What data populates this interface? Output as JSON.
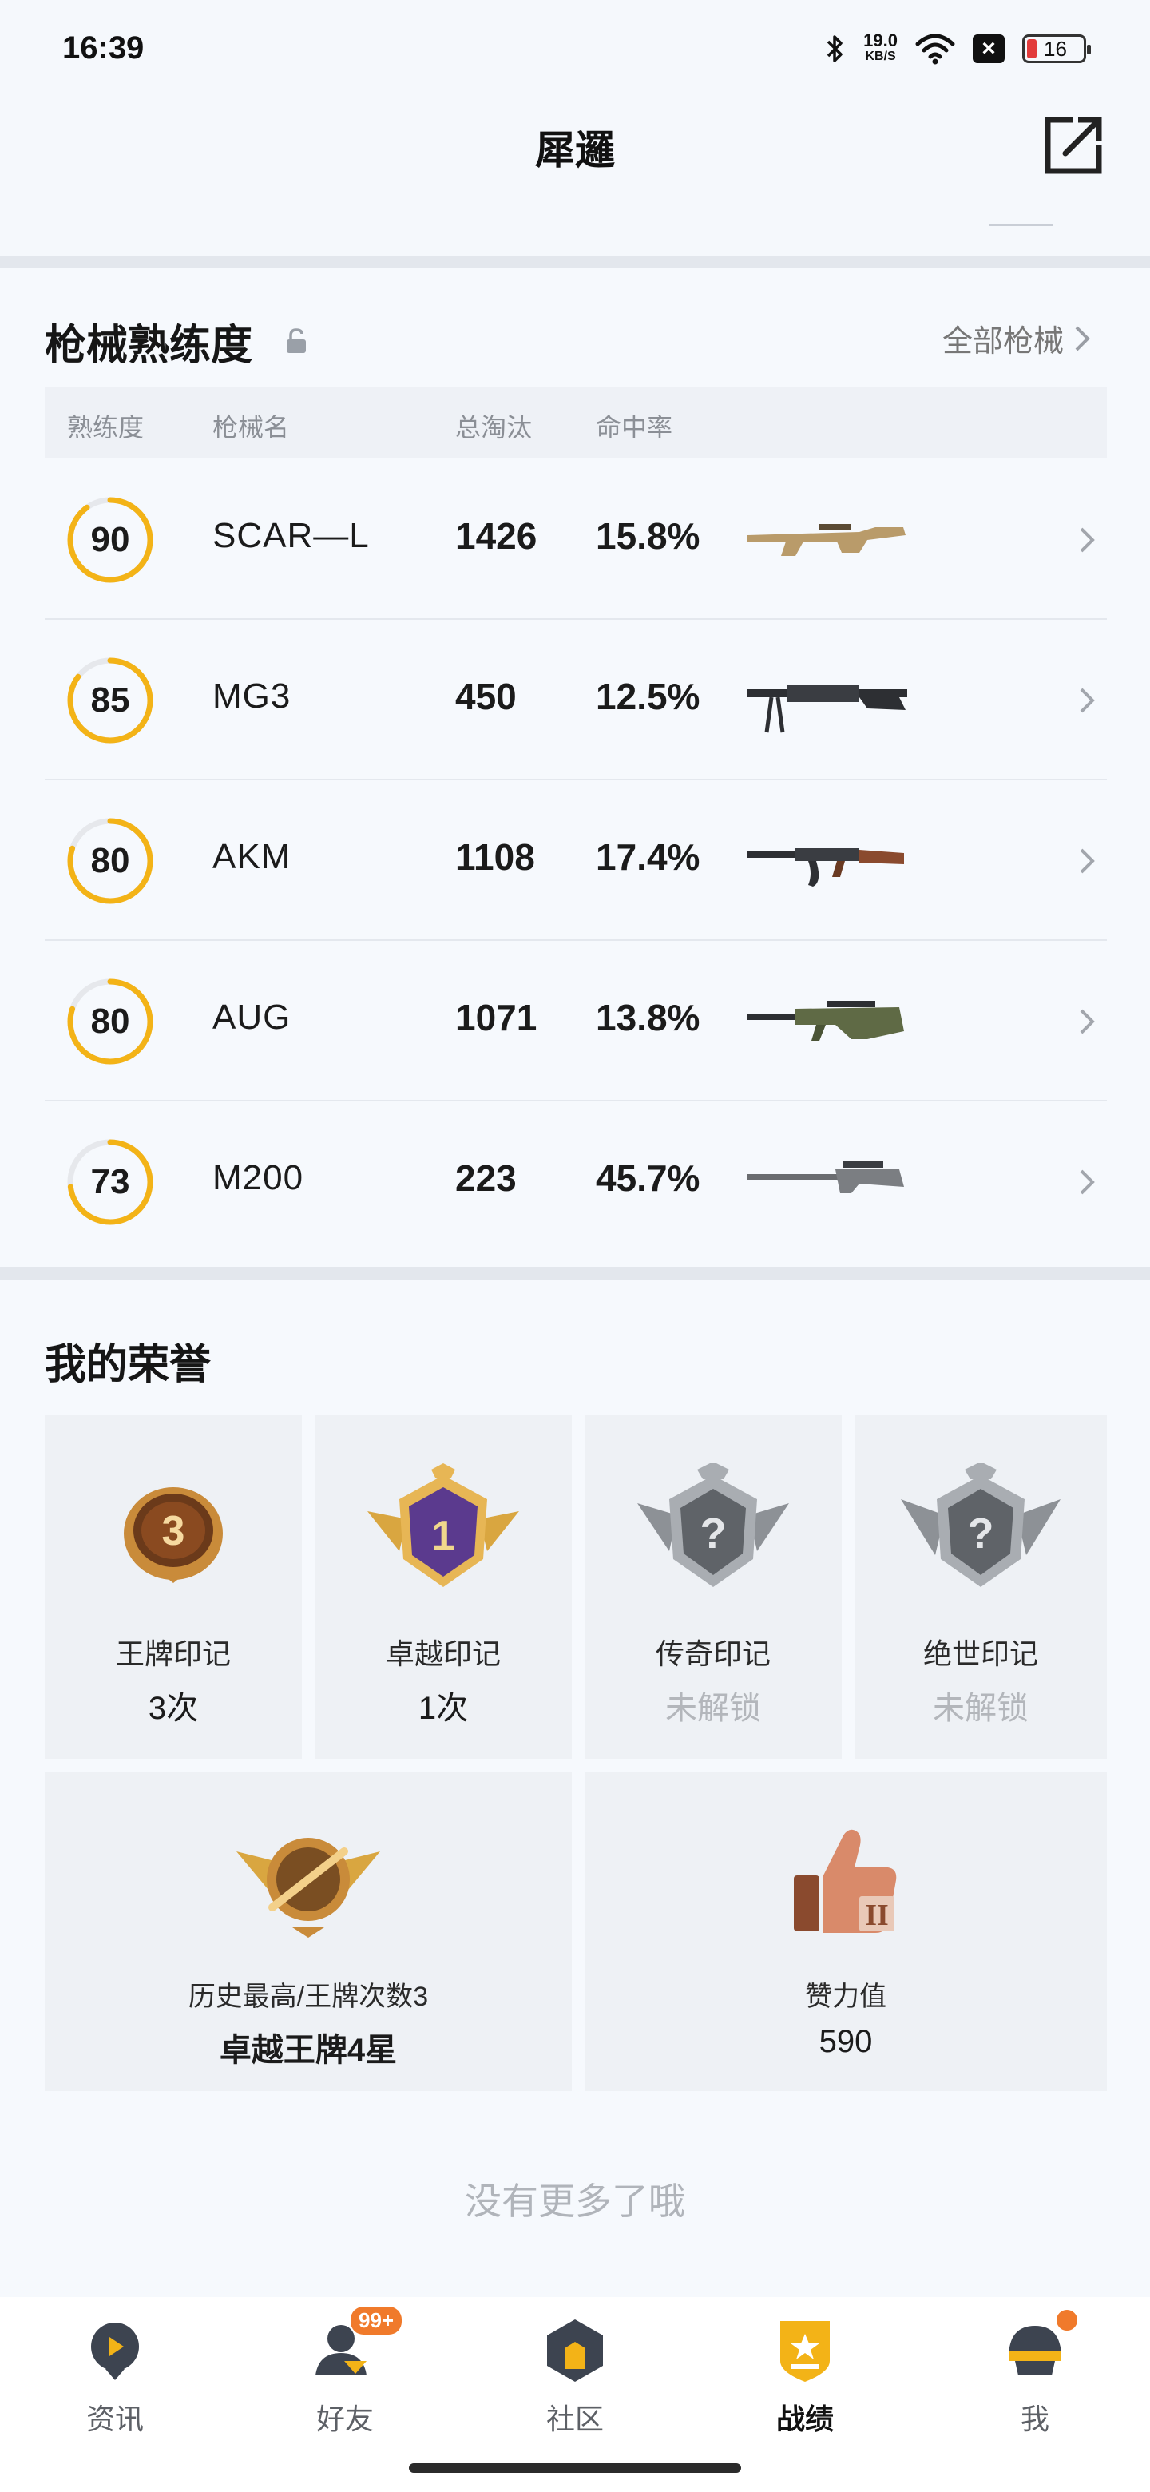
{
  "status_bar": {
    "time": "16:39",
    "net_speed": "19.0",
    "net_unit": "KB/S",
    "battery": "16",
    "icons": [
      "bluetooth-icon",
      "wifi-icon",
      "close-box-icon",
      "battery-icon"
    ]
  },
  "header": {
    "title": "犀邏",
    "share_icon": "share-external-icon"
  },
  "gun_section": {
    "title": "枪械熟练度",
    "all_label": "全部枪械",
    "columns": [
      "熟练度",
      "枪械名",
      "总淘汰",
      "命中率"
    ],
    "rows": [
      {
        "proficiency": "90",
        "fill": 0.9,
        "name": "SCAR—L",
        "kills": "1426",
        "accuracy": "15.8%",
        "gun_icon": "scar-l-rifle-icon"
      },
      {
        "proficiency": "85",
        "fill": 0.85,
        "name": "MG3",
        "kills": "450",
        "accuracy": "12.5%",
        "gun_icon": "mg3-machine-gun-icon"
      },
      {
        "proficiency": "80",
        "fill": 0.8,
        "name": "AKM",
        "kills": "1108",
        "accuracy": "17.4%",
        "gun_icon": "akm-rifle-icon"
      },
      {
        "proficiency": "80",
        "fill": 0.8,
        "name": "AUG",
        "kills": "1071",
        "accuracy": "13.8%",
        "gun_icon": "aug-rifle-icon"
      },
      {
        "proficiency": "73",
        "fill": 0.73,
        "name": "M200",
        "kills": "223",
        "accuracy": "45.7%",
        "gun_icon": "m200-sniper-icon"
      }
    ]
  },
  "honor_section": {
    "title": "我的荣誉",
    "tiles": [
      {
        "label": "王牌印记",
        "value": "3次",
        "locked": false,
        "badge_number": "3"
      },
      {
        "label": "卓越印记",
        "value": "1次",
        "locked": false,
        "badge_number": "1"
      },
      {
        "label": "传奇印记",
        "value": "未解锁",
        "locked": true,
        "badge_number": "?"
      },
      {
        "label": "绝世印记",
        "value": "未解锁",
        "locked": true,
        "badge_number": "?"
      }
    ],
    "wide_tiles": [
      {
        "label": "历史最高/王牌次数3",
        "value": "卓越王牌4星"
      },
      {
        "label": "赞力值",
        "value": "590"
      }
    ]
  },
  "footer_text": "没有更多了哦",
  "bottom_nav": {
    "items": [
      {
        "label": "资讯",
        "icon": "news-icon",
        "active": false
      },
      {
        "label": "好友",
        "icon": "friends-icon",
        "active": false,
        "badge": "99+"
      },
      {
        "label": "社区",
        "icon": "community-icon",
        "active": false
      },
      {
        "label": "战绩",
        "icon": "record-icon",
        "active": true
      },
      {
        "label": "我",
        "icon": "profile-helmet-icon",
        "active": false
      }
    ]
  },
  "colors": {
    "accent": "#f3b317",
    "ring_track": "#e6e8ec",
    "badge_orange": "#f07a2b",
    "background": "#f1f4f8"
  }
}
